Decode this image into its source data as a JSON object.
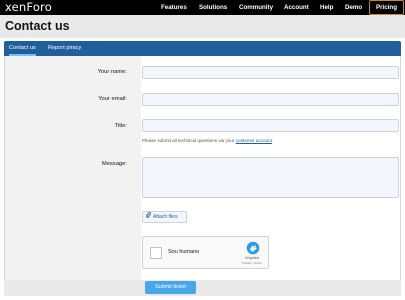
{
  "brand": {
    "logo_text": "xenForo"
  },
  "nav": {
    "items": [
      {
        "label": "Features"
      },
      {
        "label": "Solutions"
      },
      {
        "label": "Community"
      },
      {
        "label": "Account"
      },
      {
        "label": "Help"
      },
      {
        "label": "Demo"
      }
    ],
    "pricing_label": "Pricing"
  },
  "page": {
    "title": "Contact us"
  },
  "tabs": [
    {
      "label": "Contact us",
      "active": true
    },
    {
      "label": "Report piracy",
      "active": false
    }
  ],
  "form": {
    "name_label": "Your name:",
    "email_label": "Your email:",
    "title_label": "Title:",
    "title_hint_prefix": "Please submit all technical questions via your ",
    "title_hint_link": "customer account",
    "title_hint_suffix": ".",
    "message_label": "Message:",
    "attach_label": "Attach files",
    "submit_label": "Submit ticket"
  },
  "captcha": {
    "checkbox_label": "Sou humano",
    "brand": "hCaptcha",
    "terms": "Privacy - Terms"
  },
  "colors": {
    "nav_bg": "#000000",
    "tab_bar": "#1f5f9c",
    "submit": "#47a7eb",
    "pricing_border": "#c58a2b"
  }
}
